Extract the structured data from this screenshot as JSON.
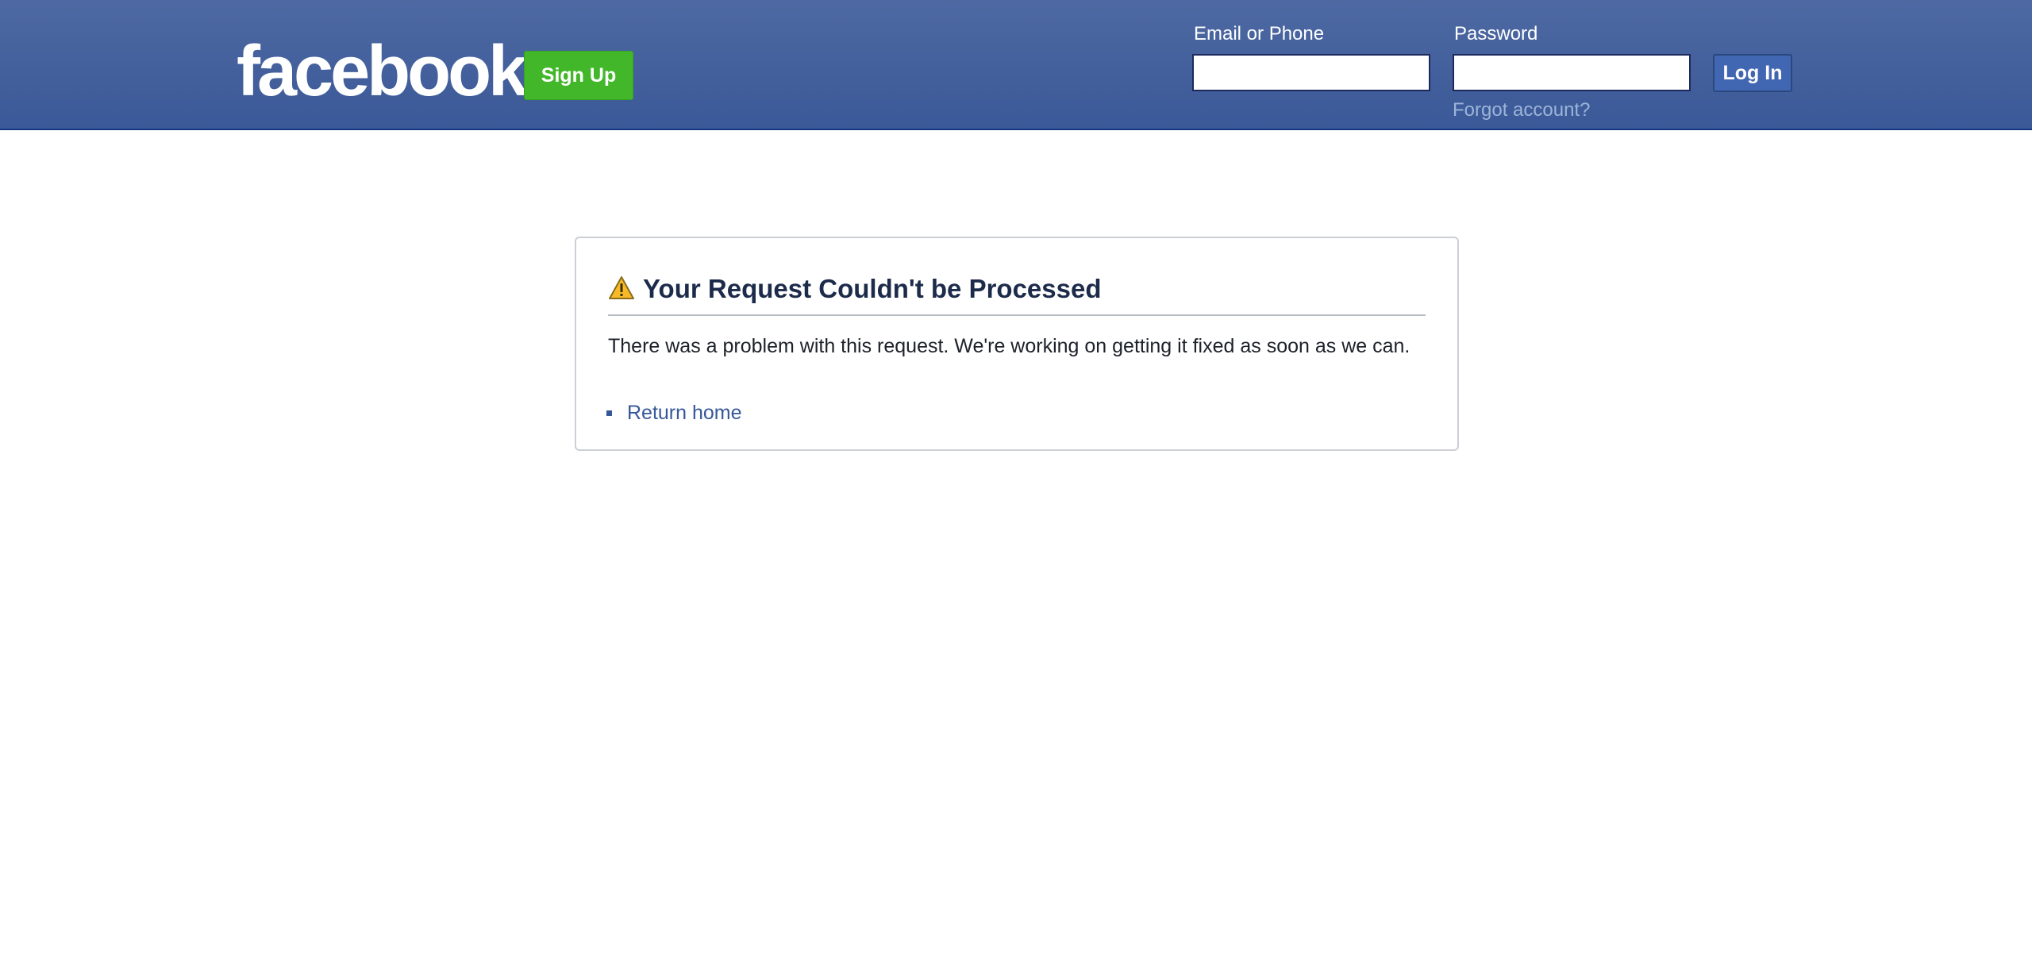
{
  "header": {
    "logo_text": "facebook",
    "signup_label": "Sign Up",
    "email_label": "Email or Phone",
    "email_value": "",
    "password_label": "Password",
    "password_value": "",
    "login_label": "Log In",
    "forgot_label": "Forgot account?"
  },
  "error": {
    "title": "Your Request Couldn't be Processed",
    "message": "There was a problem with this request. We're working on getting it fixed as soon as we can.",
    "links": [
      {
        "label": "Return home"
      }
    ]
  },
  "icons": {
    "warning": "warning-icon",
    "bullet": "square-bullet-icon"
  },
  "colors": {
    "header_blue": "#3b5998",
    "signup_green": "#42b72a",
    "login_blue": "#4267b2",
    "link_blue": "#365899",
    "forgot_link": "#9cb4d8",
    "title_text": "#1c2b4a",
    "warning_yellow": "#f7b928"
  }
}
